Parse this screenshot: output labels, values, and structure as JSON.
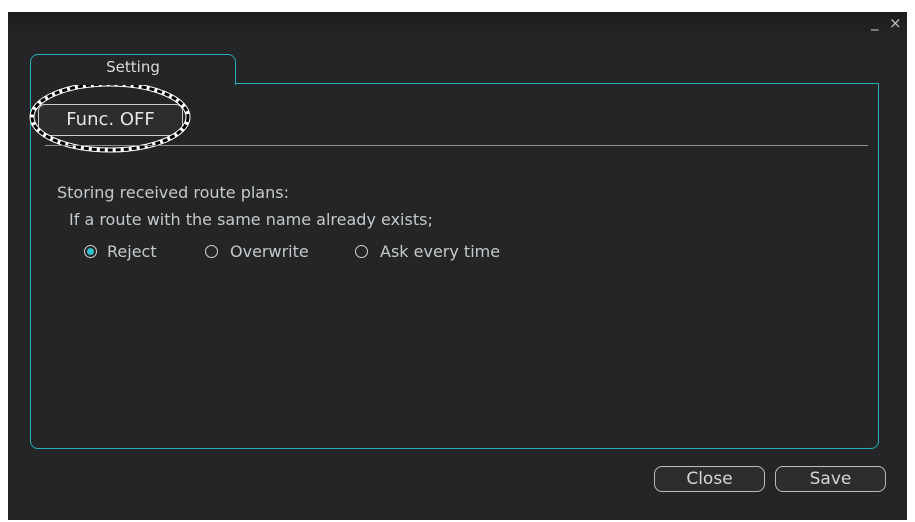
{
  "window": {
    "minimize_glyph": "_",
    "close_glyph": "×"
  },
  "tabs": [
    {
      "label": "Setting"
    }
  ],
  "func_button_label": "Func. OFF",
  "section_title": "Storing received route plans:",
  "condition_text": "If a route with the same name already exists;",
  "radio_options": [
    {
      "label": "Reject",
      "selected": true
    },
    {
      "label": "Overwrite",
      "selected": false
    },
    {
      "label": "Ask every time",
      "selected": false
    }
  ],
  "buttons": {
    "close": "Close",
    "save": "Save"
  },
  "colors": {
    "accent": "#23b0b8",
    "background": "#242526",
    "radio_selected": "#2ec3d0"
  }
}
